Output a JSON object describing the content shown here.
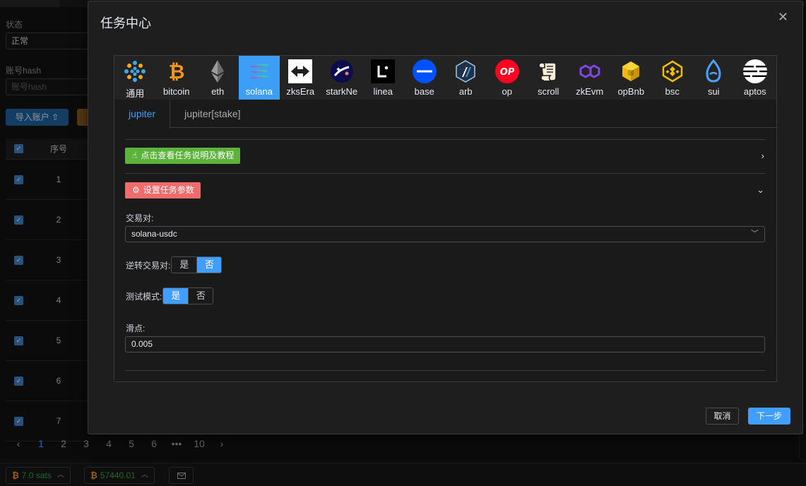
{
  "background": {
    "status_label": "状态",
    "status_value": "正常",
    "hash_label": "账号hash",
    "hash_placeholder": "账号hash",
    "import_button": "导入账户 ⇧",
    "table": {
      "header_index": "序号",
      "rows": [
        "1",
        "2",
        "3",
        "4",
        "5",
        "6",
        "7"
      ]
    },
    "pagination": [
      "1",
      "2",
      "3",
      "4",
      "5",
      "6",
      "•••",
      "10"
    ],
    "pagination_prev": "‹",
    "pagination_next": "›",
    "bottom": {
      "sats": "7.0 sats",
      "price": "57440.01"
    }
  },
  "modal": {
    "title": "任务中心",
    "close": "✕",
    "chains": [
      {
        "label": "通用",
        "icon": "generic-network-icon"
      },
      {
        "label": "bitcoin",
        "icon": "bitcoin-icon"
      },
      {
        "label": "eth",
        "icon": "ethereum-icon"
      },
      {
        "label": "solana",
        "icon": "solana-icon"
      },
      {
        "label": "zksEra",
        "icon": "zksync-icon"
      },
      {
        "label": "starkNe",
        "icon": "starknet-icon"
      },
      {
        "label": "linea",
        "icon": "linea-icon"
      },
      {
        "label": "base",
        "icon": "base-icon"
      },
      {
        "label": "arb",
        "icon": "arbitrum-icon"
      },
      {
        "label": "op",
        "icon": "optimism-icon"
      },
      {
        "label": "scroll",
        "icon": "scroll-icon"
      },
      {
        "label": "zkEvm",
        "icon": "polygon-zkevm-icon"
      },
      {
        "label": "opBnb",
        "icon": "opbnb-icon"
      },
      {
        "label": "bsc",
        "icon": "bnb-icon"
      },
      {
        "label": "sui",
        "icon": "sui-icon"
      },
      {
        "label": "aptos",
        "icon": "aptos-icon"
      }
    ],
    "op_icon_text": "OP",
    "subtabs": [
      "jupiter",
      "jupiter[stake]"
    ],
    "guide_button": "点击查看任务说明及教程",
    "params_button": "设置任务参数",
    "fields": {
      "pair_label": "交易对:",
      "pair_value": "solana-usdc",
      "reverse_label": "逆转交易对:",
      "reverse_yes": "是",
      "reverse_no": "否",
      "test_label": "测试模式:",
      "test_yes": "是",
      "test_no": "否",
      "slippage_label": "滑点:",
      "slippage_value": "0.005"
    },
    "cancel_button": "取消",
    "next_button": "下一步"
  },
  "colors": {
    "primary": "#409eff",
    "success": "#5bb33b",
    "danger": "#f06b6b",
    "active_chain": "#3d9ef6"
  }
}
